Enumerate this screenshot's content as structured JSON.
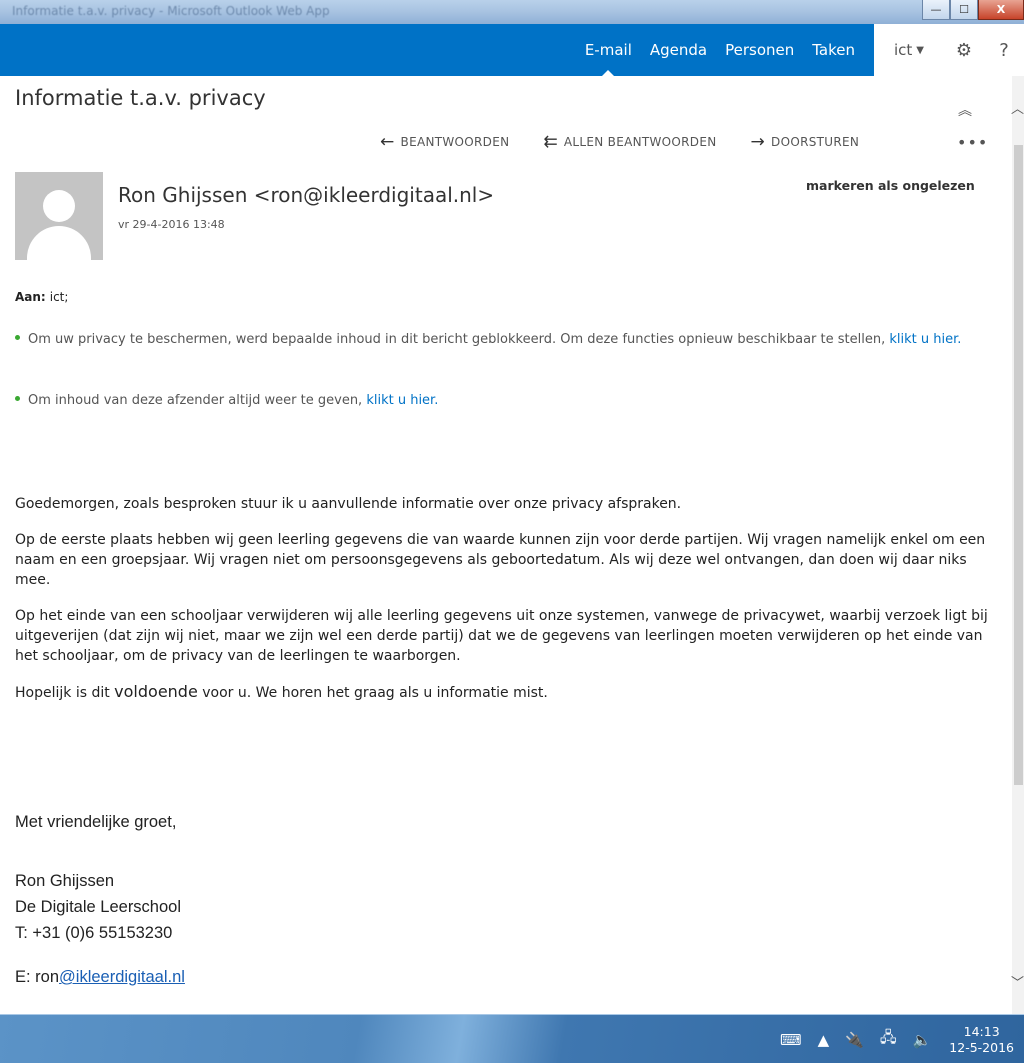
{
  "window": {
    "title": "Informatie t.a.v. privacy - Microsoft Outlook Web App",
    "minimize_label": "—",
    "maximize_label": "☐",
    "close_label": "X"
  },
  "nav": {
    "items": [
      "E-mail",
      "Agenda",
      "Personen",
      "Taken"
    ],
    "active": "E-mail",
    "user": "ict",
    "settings_icon": "gear-icon",
    "help_label": "?"
  },
  "message": {
    "subject": "Informatie t.a.v. privacy",
    "actions": {
      "reply": "BEANTWOORDEN",
      "reply_all": "ALLEN BEANTWOORDEN",
      "forward": "DOORSTUREN"
    },
    "more_label": "•••",
    "sender": "Ron Ghijssen <ron@ikleerdigitaal.nl>",
    "date": "vr 29-4-2016 13:48",
    "mark_unread": "markeren als ongelezen",
    "to_label": "Aan:",
    "to_value": "ict;",
    "notice1_text": "Om uw privacy te beschermen, werd bepaalde inhoud in dit bericht geblokkeerd. Om deze functies opnieuw beschikbaar te stellen, ",
    "notice1_link": "klikt u hier.",
    "notice2_text": "Om inhoud van deze afzender altijd weer te geven, ",
    "notice2_link": "klikt u hier.",
    "body": {
      "p1": "Goedemorgen, zoals besproken stuur ik u aanvullende informatie over onze privacy afspraken.",
      "p2": "Op de eerste plaats hebben wij geen leerling gegevens die van waarde kunnen zijn voor derde partijen. Wij vragen namelijk enkel om een naam en een groepsjaar. Wij vragen niet om persoonsgegevens als geboortedatum. Als wij deze wel ontvangen, dan doen wij daar niks mee.",
      "p3": "Op het einde van een schooljaar verwijderen wij alle leerling gegevens uit onze systemen, vanwege de privacywet, waarbij verzoek ligt bij uitgeverijen (dat zijn wij niet, maar we zijn wel een derde partij) dat we de gegevens van leerlingen moeten verwijderen op het einde van het schooljaar, om de privacy van de leerlingen te waarborgen.",
      "p4_before": "Hopelijk is dit ",
      "p4_emph": "voldoende",
      "p4_after": " voor u. We horen het graag als u informatie mist."
    },
    "signature": {
      "greeting": "Met vriendelijke groet,",
      "name": "Ron Ghijssen",
      "company": "De Digitale Leerschool",
      "phone": "T: +31 (0)6 55153230",
      "email_prefix": "E: ron",
      "email_link": "@ikleerdigitaal.nl"
    }
  },
  "taskbar": {
    "time": "14:13",
    "date": "12-5-2016"
  },
  "colors": {
    "nav_bg": "#0072c6",
    "link": "#0072c6",
    "notice_dot": "#3aa832"
  }
}
